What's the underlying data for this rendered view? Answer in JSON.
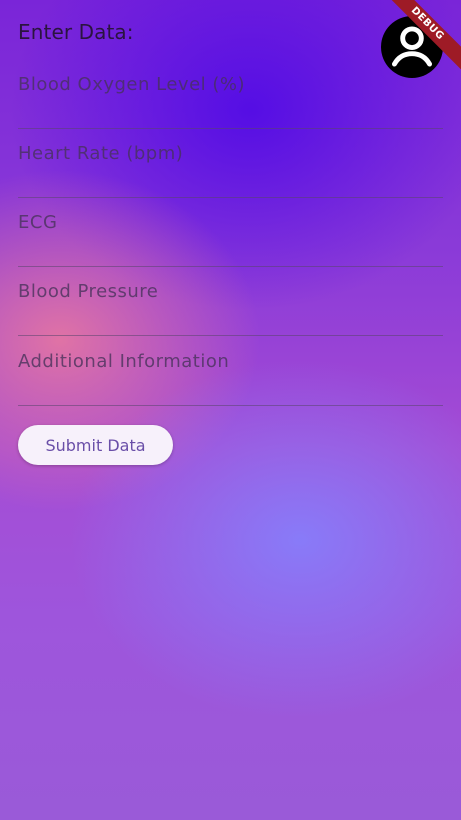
{
  "form": {
    "heading": "Enter Data:",
    "fields": [
      {
        "placeholder": "Blood Oxygen Level (%)",
        "value": ""
      },
      {
        "placeholder": "Heart Rate (bpm)",
        "value": ""
      },
      {
        "placeholder": "ECG",
        "value": ""
      },
      {
        "placeholder": "Blood Pressure",
        "value": ""
      },
      {
        "placeholder": "Additional Information",
        "value": ""
      }
    ],
    "submit_label": "Submit Data"
  },
  "header": {
    "avatar_icon": "account-circle-icon"
  },
  "debug_banner": {
    "label": "DEBUG",
    "color": "#9e1b26"
  }
}
